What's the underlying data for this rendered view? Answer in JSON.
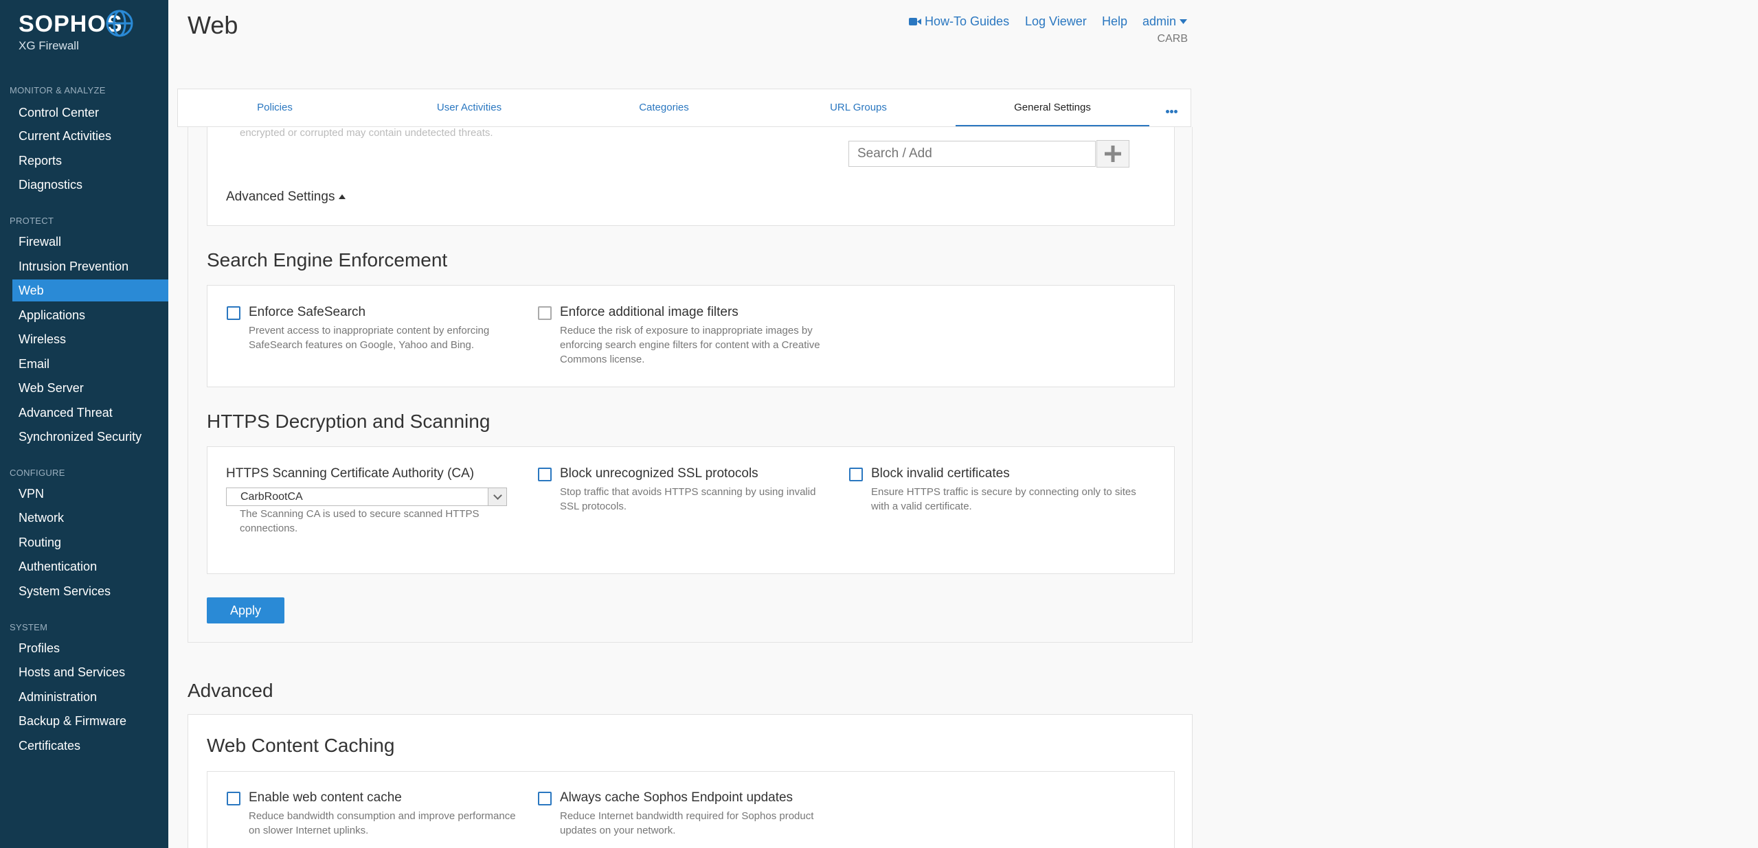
{
  "app": {
    "brand": "SOPHOS",
    "product": "XG Firewall"
  },
  "sidebar": {
    "sections": [
      {
        "title": "MONITOR & ANALYZE",
        "items": [
          "Control Center",
          "Current Activities",
          "Reports",
          "Diagnostics"
        ]
      },
      {
        "title": "PROTECT",
        "items": [
          "Firewall",
          "Intrusion Prevention",
          "Web",
          "Applications",
          "Wireless",
          "Email",
          "Web Server",
          "Advanced Threat",
          "Synchronized Security"
        ]
      },
      {
        "title": "CONFIGURE",
        "items": [
          "VPN",
          "Network",
          "Routing",
          "Authentication",
          "System Services"
        ]
      },
      {
        "title": "SYSTEM",
        "items": [
          "Profiles",
          "Hosts and Services",
          "Administration",
          "Backup & Firmware",
          "Certificates"
        ]
      }
    ],
    "active": "Web"
  },
  "header": {
    "title": "Web",
    "how_to": "How-To Guides",
    "log_viewer": "Log Viewer",
    "help": "Help",
    "admin": "admin",
    "device": "CARB"
  },
  "tabs": [
    "Policies",
    "User Activities",
    "Categories",
    "URL Groups",
    "General Settings"
  ],
  "active_tab": "General Settings",
  "top_partial": {
    "faded_text": "encrypted or corrupted may contain undetected threats.",
    "search_placeholder": "Search / Add",
    "advanced_settings": "Advanced Settings"
  },
  "search_engine": {
    "title": "Search Engine Enforcement",
    "safesearch_label": "Enforce SafeSearch",
    "safesearch_desc_1": "Prevent access to inappropriate content by enforcing",
    "safesearch_desc_2": "SafeSearch features on Google, Yahoo and Bing.",
    "image_filters_label": "Enforce additional image filters",
    "image_filters_desc_1": "Reduce the risk of exposure to inappropriate images by",
    "image_filters_desc_2": "enforcing search engine filters for content with a Creative",
    "image_filters_desc_3": "Commons license."
  },
  "https": {
    "title": "HTTPS Decryption and Scanning",
    "ca_label": "HTTPS Scanning Certificate Authority (CA)",
    "ca_value": "CarbRootCA",
    "ca_desc_1": "The Scanning CA is used to secure scanned HTTPS",
    "ca_desc_2": "connections.",
    "ssl_label": "Block unrecognized SSL protocols",
    "ssl_desc_1": "Stop traffic that avoids HTTPS scanning by using invalid",
    "ssl_desc_2": "SSL protocols.",
    "invalid_label": "Block invalid certificates",
    "invalid_desc_1": "Ensure HTTPS traffic is secure by connecting only to sites",
    "invalid_desc_2": "with a valid certificate."
  },
  "apply": "Apply",
  "advanced": {
    "title": "Advanced",
    "caching_title": "Web Content Caching",
    "cache_label": "Enable web content cache",
    "cache_desc_1": "Reduce bandwidth consumption and improve performance",
    "cache_desc_2": "on slower Internet uplinks.",
    "endpoint_label": "Always cache Sophos Endpoint updates",
    "endpoint_desc_1": "Reduce Internet bandwidth required for Sophos product",
    "endpoint_desc_2": "updates on your network."
  },
  "colors": {
    "sidebar_bg": "#13394f",
    "active_nav": "#2a8ad6",
    "link": "#2a77c0"
  }
}
